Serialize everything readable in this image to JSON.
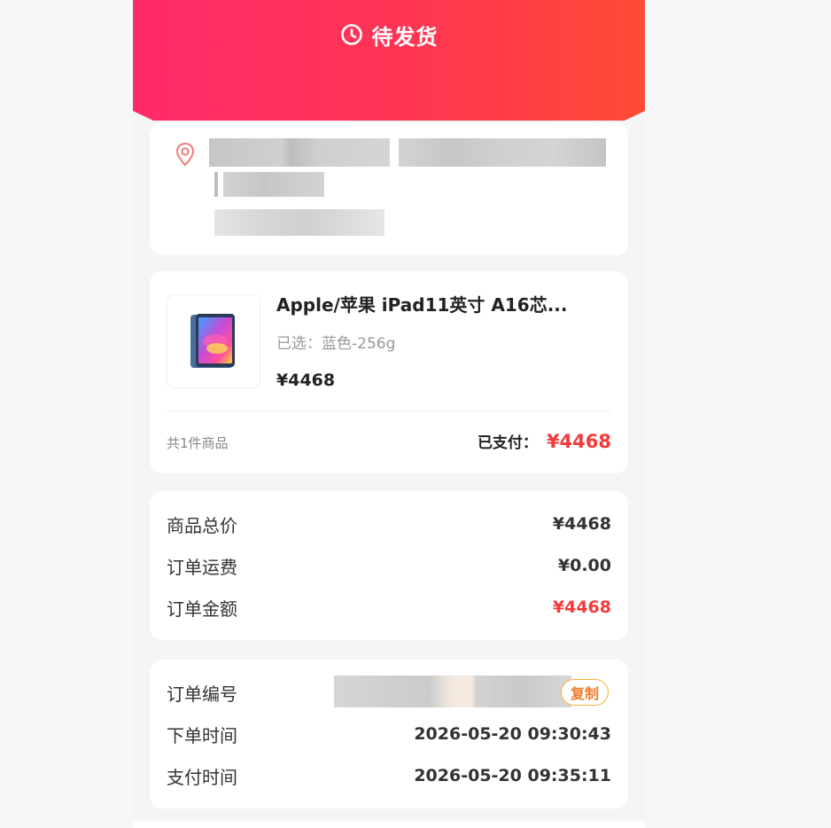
{
  "header": {
    "status": "待发货",
    "icon": "clock-icon"
  },
  "address": {
    "icon": "location-pin-icon",
    "redacted": true
  },
  "product": {
    "title": "Apple/苹果 iPad11英寸 A16芯...",
    "spec": "已选：蓝色-256g",
    "price": "¥4468",
    "count": "共1件商品",
    "paid_label": "已支付：",
    "paid_amount": "¥4468"
  },
  "prices": {
    "rows": [
      {
        "label": "商品总价",
        "value": "¥4468"
      },
      {
        "label": "订单运费",
        "value": "¥0.00"
      },
      {
        "label": "订单金额",
        "value": "¥4468"
      }
    ]
  },
  "order_info": {
    "number_label": "订单编号",
    "copy_label": "复制",
    "rows": [
      {
        "label": "下单时间",
        "value": "2026-05-20 09:30:43"
      },
      {
        "label": "支付时间",
        "value": "2026-05-20 09:35:11"
      }
    ]
  },
  "colors": {
    "accent_red": "#f53a3a",
    "header_start": "#ff2a6a",
    "header_end": "#ff4a35",
    "copy_border": "#f5b33a"
  }
}
